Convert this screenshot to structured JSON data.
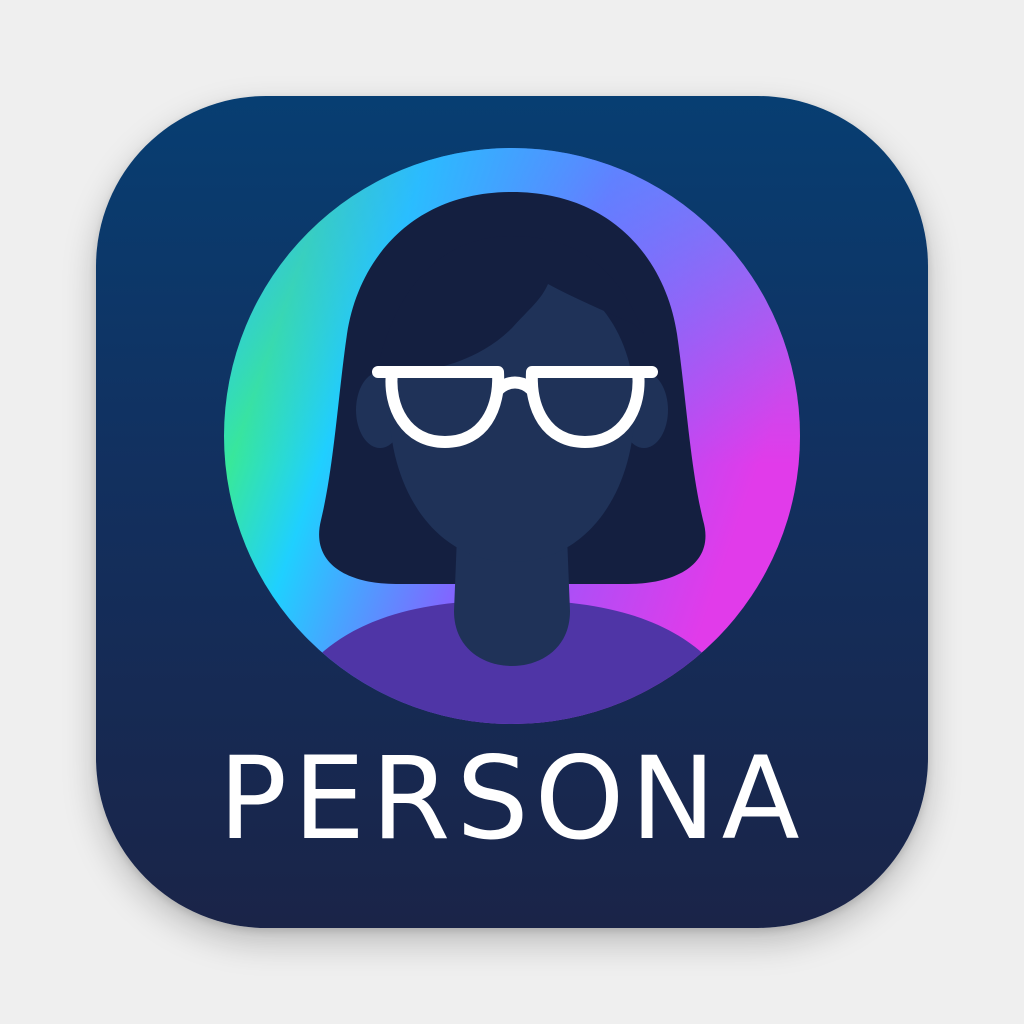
{
  "app": {
    "name": "PERSONA"
  },
  "icons": {
    "avatar": "user-avatar-with-glasses-icon",
    "glasses": "glasses-icon"
  },
  "colors": {
    "page_background": "#efefef",
    "tile_top": "#073e72",
    "tile_bottom": "#1a2448",
    "ring_cyan": "#1fd0ff",
    "ring_green": "#38e89a",
    "ring_violet": "#8a5cff",
    "ring_magenta": "#e13bea",
    "hair": "#141f40",
    "skin": "#1f3258",
    "shirt": "#4f35a6",
    "text": "#ffffff"
  }
}
